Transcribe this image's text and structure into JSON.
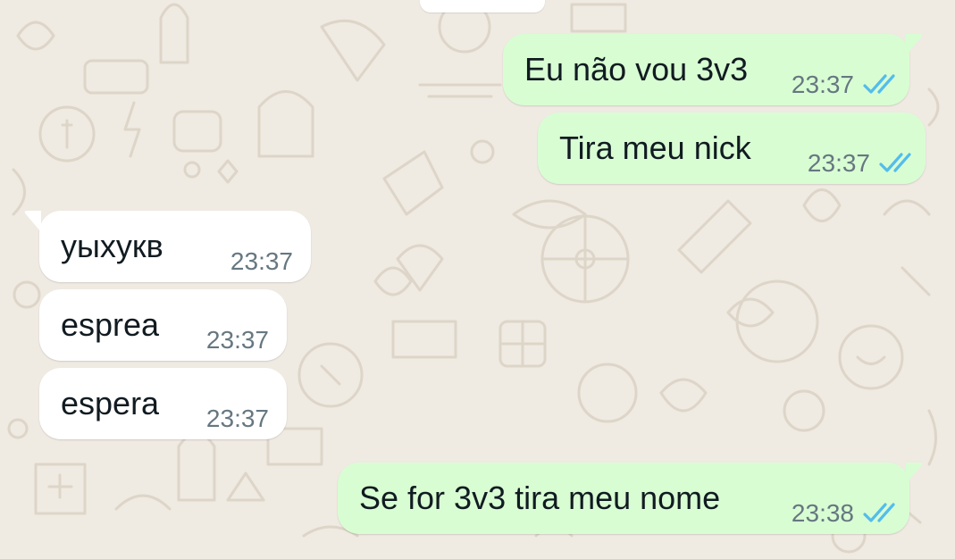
{
  "colors": {
    "background": "#efeae2",
    "outgoing_bubble": "#d9fdd3",
    "incoming_bubble": "#ffffff",
    "read_ticks": "#53bdeb",
    "time_text": "#667781",
    "message_text": "#111b21"
  },
  "messages": [
    {
      "direction": "outgoing",
      "text": "Eu não vou 3v3",
      "time": "23:37",
      "status_icon": "double-check-read-icon"
    },
    {
      "direction": "outgoing",
      "text": "Tira meu nick",
      "time": "23:37",
      "status_icon": "double-check-read-icon"
    },
    {
      "direction": "incoming",
      "text": "уыхукв",
      "time": "23:37"
    },
    {
      "direction": "incoming",
      "text": "esprea",
      "time": "23:37"
    },
    {
      "direction": "incoming",
      "text": "espera",
      "time": "23:37"
    },
    {
      "direction": "outgoing",
      "text": "Se for 3v3 tira meu nome",
      "time": "23:38",
      "status_icon": "double-check-read-icon"
    }
  ]
}
